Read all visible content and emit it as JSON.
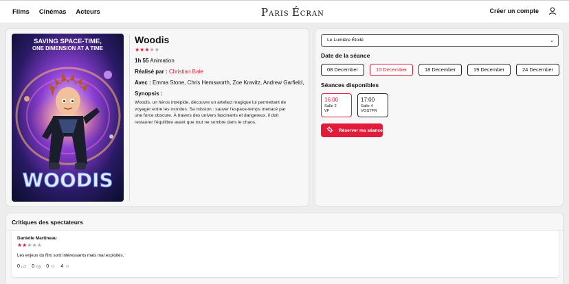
{
  "header": {
    "nav": [
      "Films",
      "Cinémas",
      "Acteurs"
    ],
    "logo": {
      "part1": "P",
      "part2": "ARIS ",
      "part3": "É",
      "part4": "CRAN"
    },
    "account_label": "Créer un compte",
    "user_icon": "user-icon"
  },
  "movie": {
    "poster_tagline1": "SAVING SPACE-TIME,",
    "poster_tagline2": "ONE DIMENSION AT A TIME",
    "poster_title": "WOODIS",
    "title": "Woodis",
    "rating": 3,
    "rating_max": 5,
    "duration": "1h 55",
    "genre": "Animation",
    "director_label": "Réalisé par :",
    "director": "Christian Bale",
    "cast_label": "Avec :",
    "cast": "Emma Stone, Chris Hemsworth, Zoe Kravitz, Andrew Garfield,",
    "synopsis_label": "Synopsis :",
    "synopsis": "Woodis, un héros intrépide, découvre un artefact magique lui permettant de voyager entre les mondes. Sa mission : sauver l'espace-temps menacé par une force obscure. À travers des univers fascinants et dangereux, il doit restaurer l'équilibre avant que tout ne sombre dans le chaos."
  },
  "sessions": {
    "cinema_selected": "Le Lumière Étoilé",
    "date_label": "Date de la séance",
    "dates": [
      {
        "label": "08 December",
        "active": false
      },
      {
        "label": "10 December",
        "active": true
      },
      {
        "label": "18 December",
        "active": false
      },
      {
        "label": "19 December",
        "active": false
      },
      {
        "label": "24 December",
        "active": false
      }
    ],
    "shows_label": "Séances disponibles",
    "shows": [
      {
        "time": "16:00",
        "room": "Salle 2",
        "version": "VF",
        "active": true
      },
      {
        "time": "17:00",
        "room": "Salle 4",
        "version": "VOSTFR",
        "active": false
      }
    ],
    "reserve_label": "Réserver ma séance",
    "reserve_icon": "ticket-icon"
  },
  "reviews": {
    "title": "Critiques des spectateurs",
    "items": [
      {
        "author": "Danielle Martineau",
        "rating": 2,
        "rating_max": 5,
        "text": "Les enjeux du film sont intéressants mais mal exploités.",
        "reactions": [
          {
            "count": "0",
            "icon": "thumbs-up-icon"
          },
          {
            "count": "0",
            "icon": "thumbs-down-icon"
          },
          {
            "count": "0",
            "icon": "smile-icon"
          },
          {
            "count": "4",
            "icon": "laugh-icon"
          }
        ]
      }
    ]
  },
  "colors": {
    "accent": "#e31b3a",
    "background": "#ededed",
    "card": "#f7f7f7"
  }
}
